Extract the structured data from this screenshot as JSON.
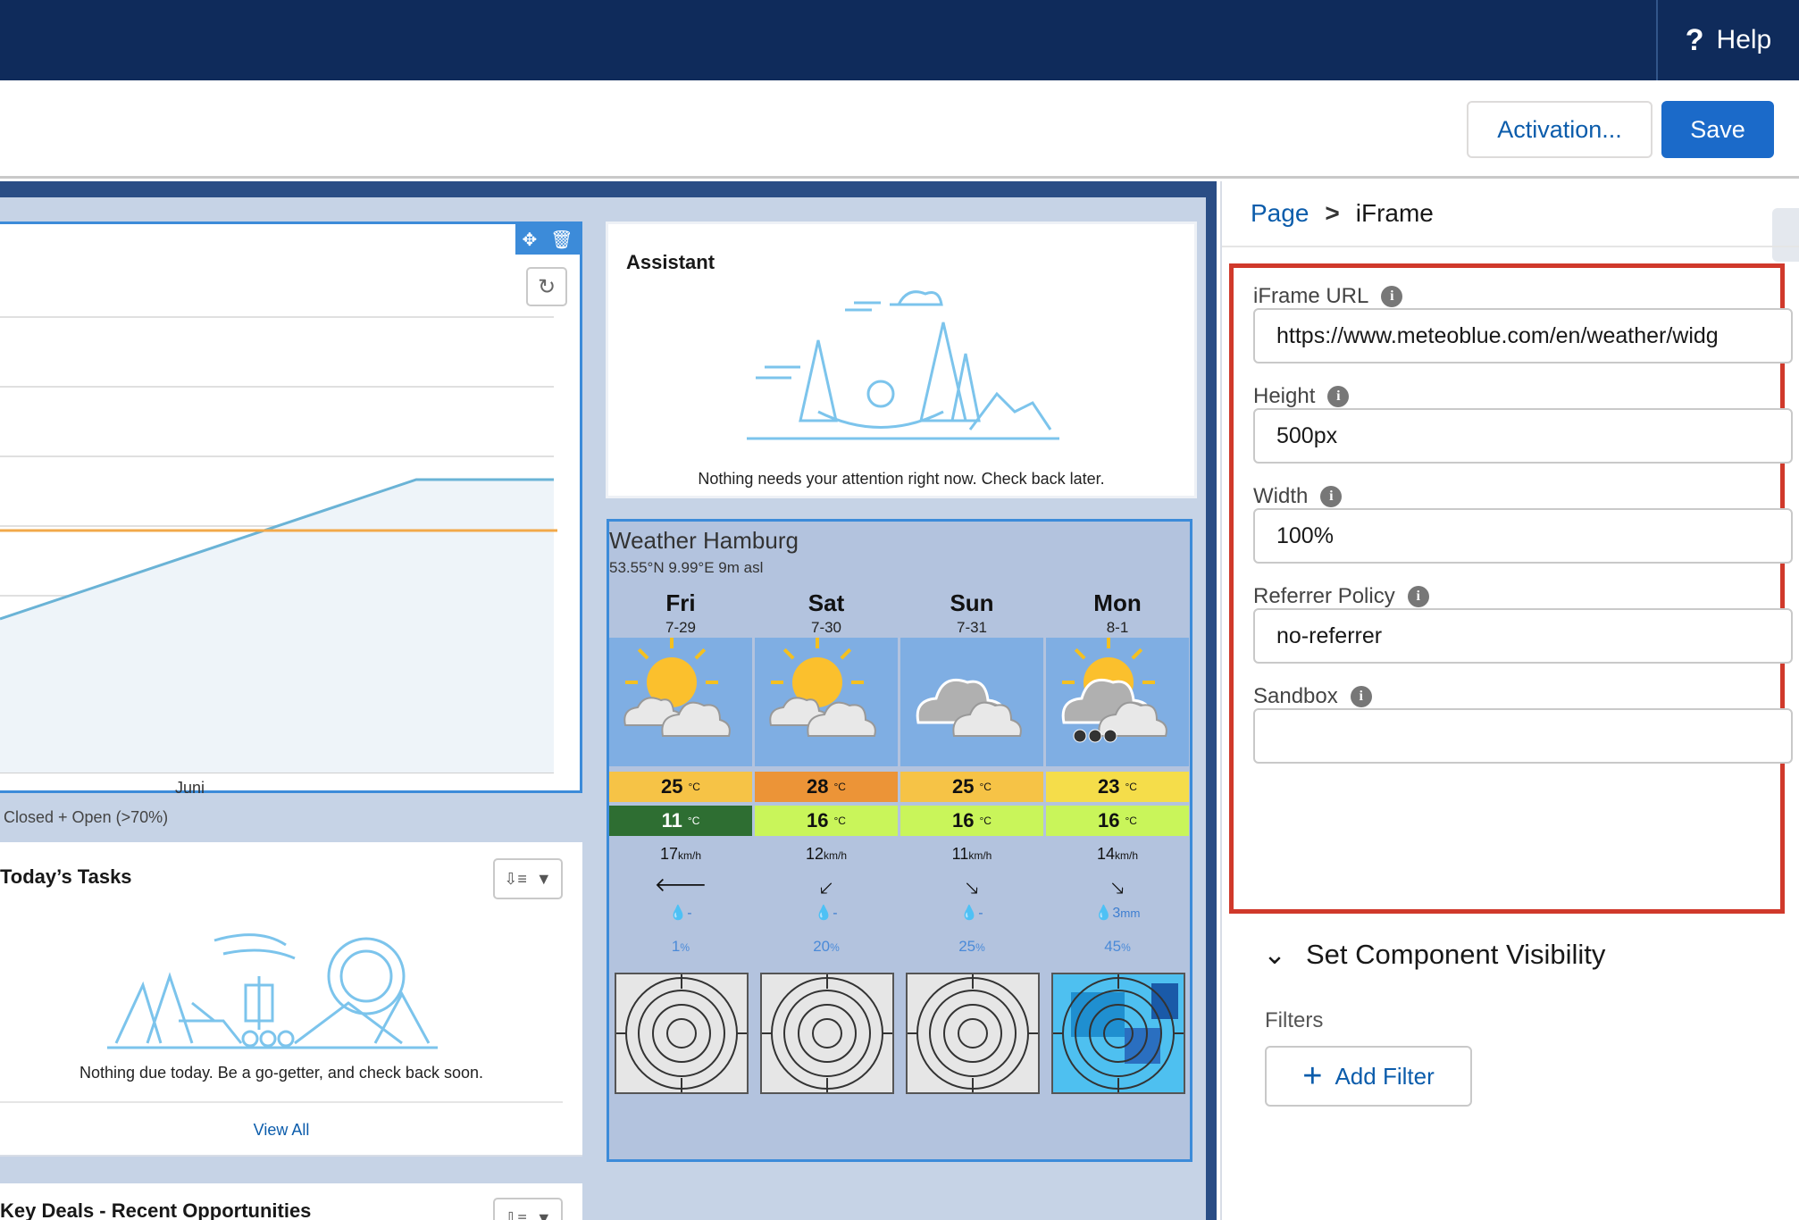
{
  "header": {
    "help_label": "Help"
  },
  "toolbar": {
    "activation_label": "Activation...",
    "save_label": "Save"
  },
  "chart": {
    "x_tick": "Juni",
    "legend": "Closed + Open (>70%)",
    "chart_data": {
      "type": "area",
      "series": [
        {
          "name": "Closed + Open (>70%)",
          "type": "area",
          "color": "#6ab3d6"
        },
        {
          "type": "line",
          "color": "#f2a94a"
        }
      ],
      "x_tick_labels": [
        "Juni"
      ],
      "grid": true
    }
  },
  "tasks": {
    "title": "Today’s Tasks",
    "empty_message": "Nothing due today. Be a go-getter, and check back soon.",
    "view_all": "View All"
  },
  "deals": {
    "title": "Key Deals - Recent Opportunities"
  },
  "assistant": {
    "title": "Assistant",
    "empty_message": "Nothing needs your attention right now. Check back later."
  },
  "weather": {
    "title": "Weather Hamburg",
    "coords": "53.55°N 9.99°E 9m asl",
    "temp_unit": "°C",
    "wind_unit": "km/h",
    "precip_unit": "mm",
    "prob_unit": "%",
    "days": [
      {
        "name": "Fri",
        "date": "7-29",
        "icon": "sun-cloud-icon",
        "tmax": "25",
        "tmin": "11",
        "tmax_color": "#f6c346",
        "tmin_color": "#2e6e32",
        "wind": "17",
        "wind_arrow": "🡐",
        "precip": "-",
        "prob": "1"
      },
      {
        "name": "Sat",
        "date": "7-30",
        "icon": "sun-cloud-icon",
        "tmax": "28",
        "tmin": "16",
        "tmax_color": "#ec9437",
        "tmin_color": "#c9f55a",
        "wind": "12",
        "wind_arrow": "🡗",
        "precip": "-",
        "prob": "20"
      },
      {
        "name": "Sun",
        "date": "7-31",
        "icon": "cloud-icon",
        "tmax": "25",
        "tmin": "16",
        "tmax_color": "#f6c346",
        "tmin_color": "#c9f55a",
        "wind": "11",
        "wind_arrow": "🡖",
        "precip": "-",
        "prob": "25"
      },
      {
        "name": "Mon",
        "date": "8-1",
        "icon": "sun-cloud-rain-icon",
        "tmax": "23",
        "tmin": "16",
        "tmax_color": "#f5dd4a",
        "tmin_color": "#c9f55a",
        "wind": "14",
        "wind_arrow": "🡖",
        "precip": "3",
        "prob": "45"
      }
    ]
  },
  "panel": {
    "breadcrumb": {
      "parent": "Page",
      "separator": ">",
      "current": "iFrame"
    },
    "fields": {
      "url": {
        "label": "iFrame URL",
        "value": "https://www.meteoblue.com/en/weather/widg"
      },
      "height": {
        "label": "Height",
        "value": "500px"
      },
      "width": {
        "label": "Width",
        "value": "100%"
      },
      "referrer": {
        "label": "Referrer Policy",
        "value": "no-referrer"
      },
      "sandbox": {
        "label": "Sandbox",
        "value": ""
      }
    },
    "visibility": {
      "title": "Set Component Visibility",
      "filters_label": "Filters",
      "add_filter": "Add Filter"
    }
  },
  "colors": {
    "header_bg": "#0f2b5b",
    "brand_blue": "#1b6ac9",
    "highlight_red": "#d0392b"
  }
}
